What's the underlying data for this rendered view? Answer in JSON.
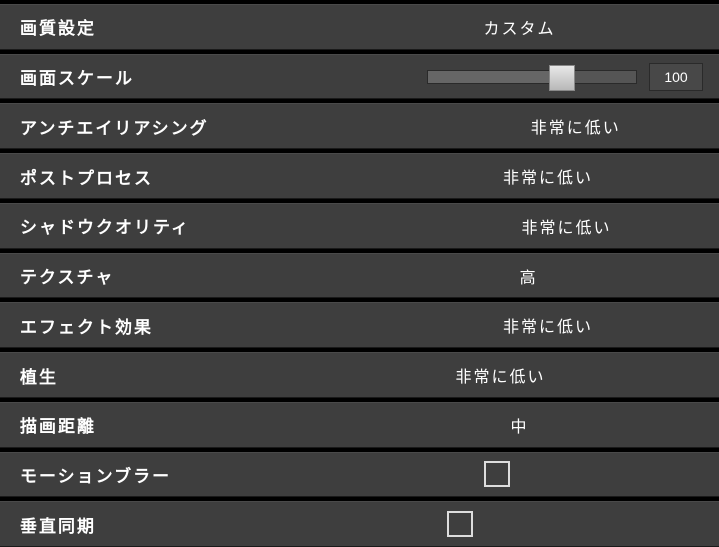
{
  "settings": {
    "quality": {
      "label": "画質設定",
      "value": "カスタム"
    },
    "scale": {
      "label": "画面スケール",
      "value": "100",
      "slider_percent": 60
    },
    "antialiasing": {
      "label": "アンチエイリアシング",
      "value": "非常に低い"
    },
    "postprocess": {
      "label": "ポストプロセス",
      "value": "非常に低い"
    },
    "shadow": {
      "label": "シャドウクオリティ",
      "value": "非常に低い"
    },
    "texture": {
      "label": "テクスチャ",
      "value": "高"
    },
    "effect": {
      "label": "エフェクト効果",
      "value": "非常に低い"
    },
    "foliage": {
      "label": "植生",
      "value": "非常に低い"
    },
    "drawdistance": {
      "label": "描画距離",
      "value": "中"
    },
    "motionblur": {
      "label": "モーションブラー",
      "checked": false
    },
    "vsync": {
      "label": "垂直同期",
      "checked": false
    }
  }
}
